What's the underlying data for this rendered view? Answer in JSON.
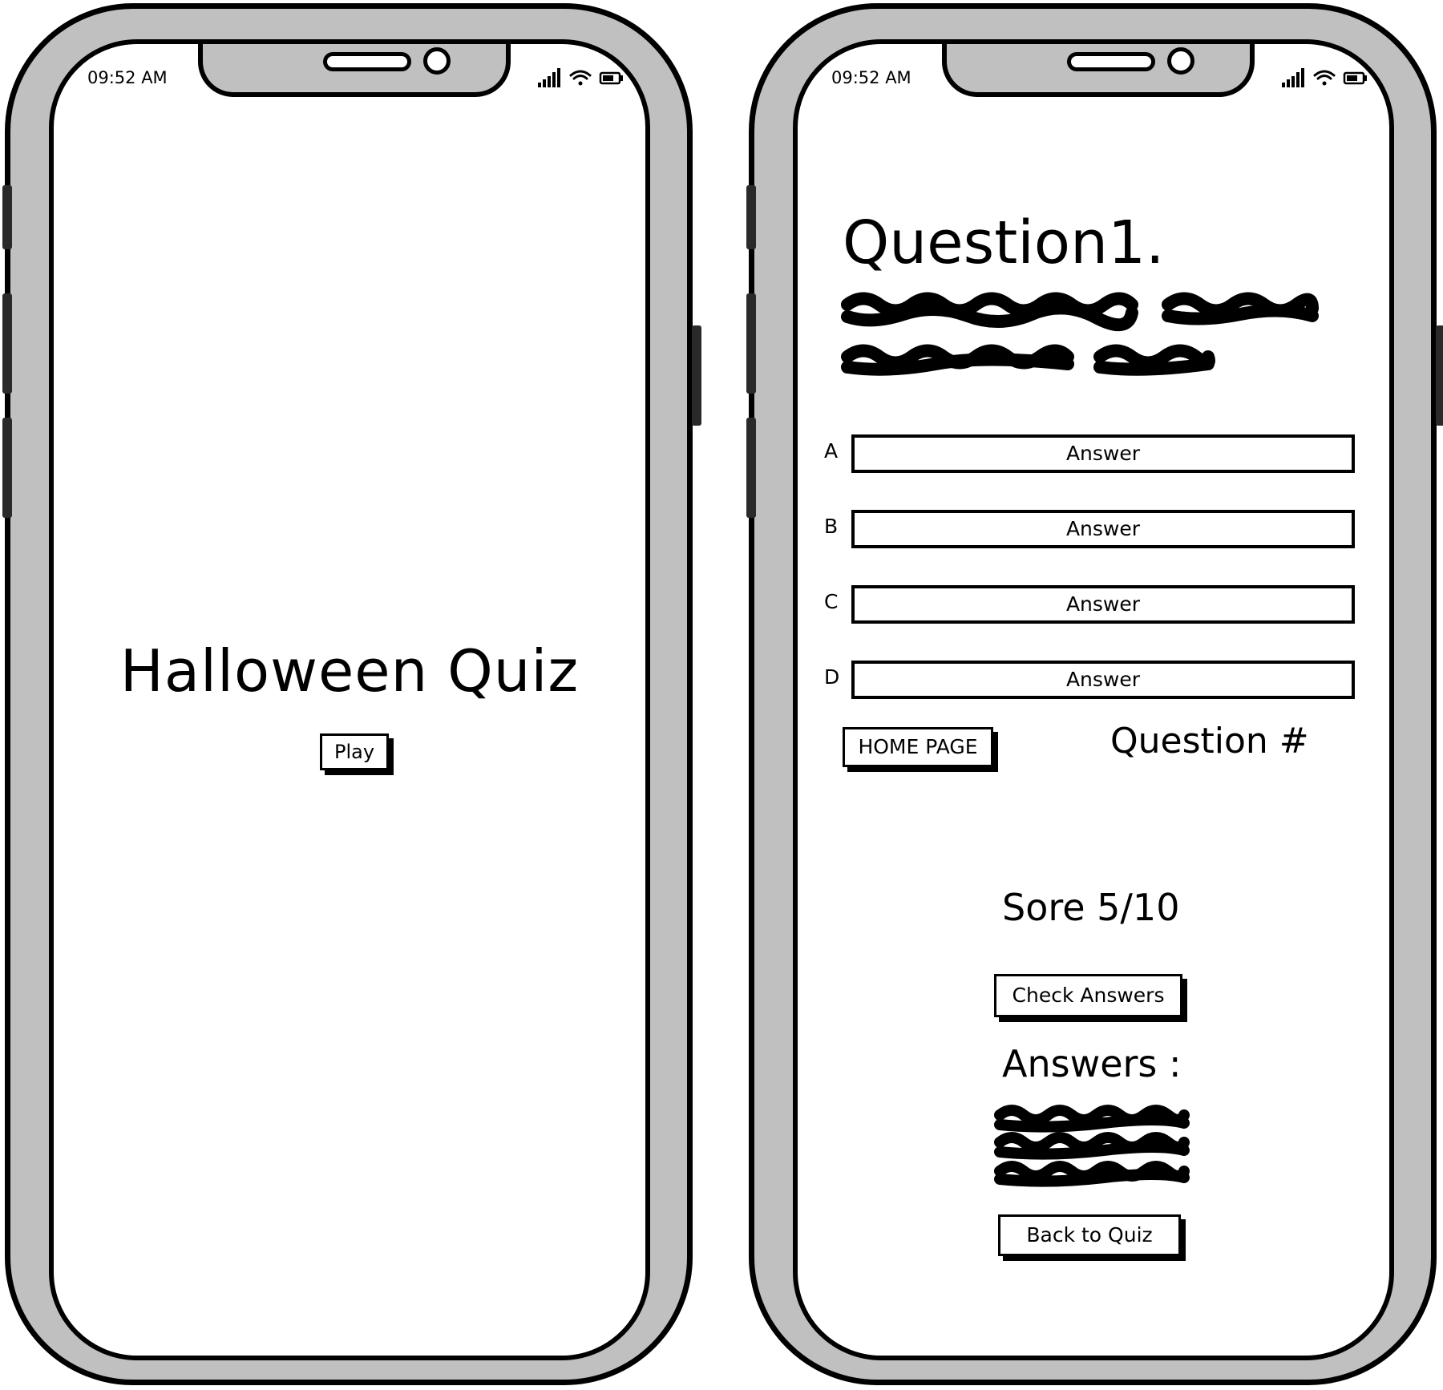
{
  "left_screen": {
    "status_time": "09:52 AM",
    "title": "Halloween Quiz",
    "play_label": "Play"
  },
  "right_screen": {
    "status_time": "09:52 AM",
    "question_title": "Question1.",
    "options": [
      {
        "letter": "A",
        "label": "Answer"
      },
      {
        "letter": "B",
        "label": "Answer"
      },
      {
        "letter": "C",
        "label": "Answer"
      },
      {
        "letter": "D",
        "label": "Answer"
      }
    ],
    "home_label": "HOME PAGE",
    "question_number": "Question #",
    "score": "Sore 5/10",
    "check_label": "Check Answers",
    "answers_label": "Answers :",
    "back_label": "Back to Quiz"
  },
  "icons": [
    "signal-icon",
    "wifi-icon",
    "battery-icon",
    "speaker-icon",
    "camera-icon"
  ],
  "colors": {
    "frame": "#c0c0c0",
    "ink": "#000000",
    "screen": "#ffffff"
  }
}
